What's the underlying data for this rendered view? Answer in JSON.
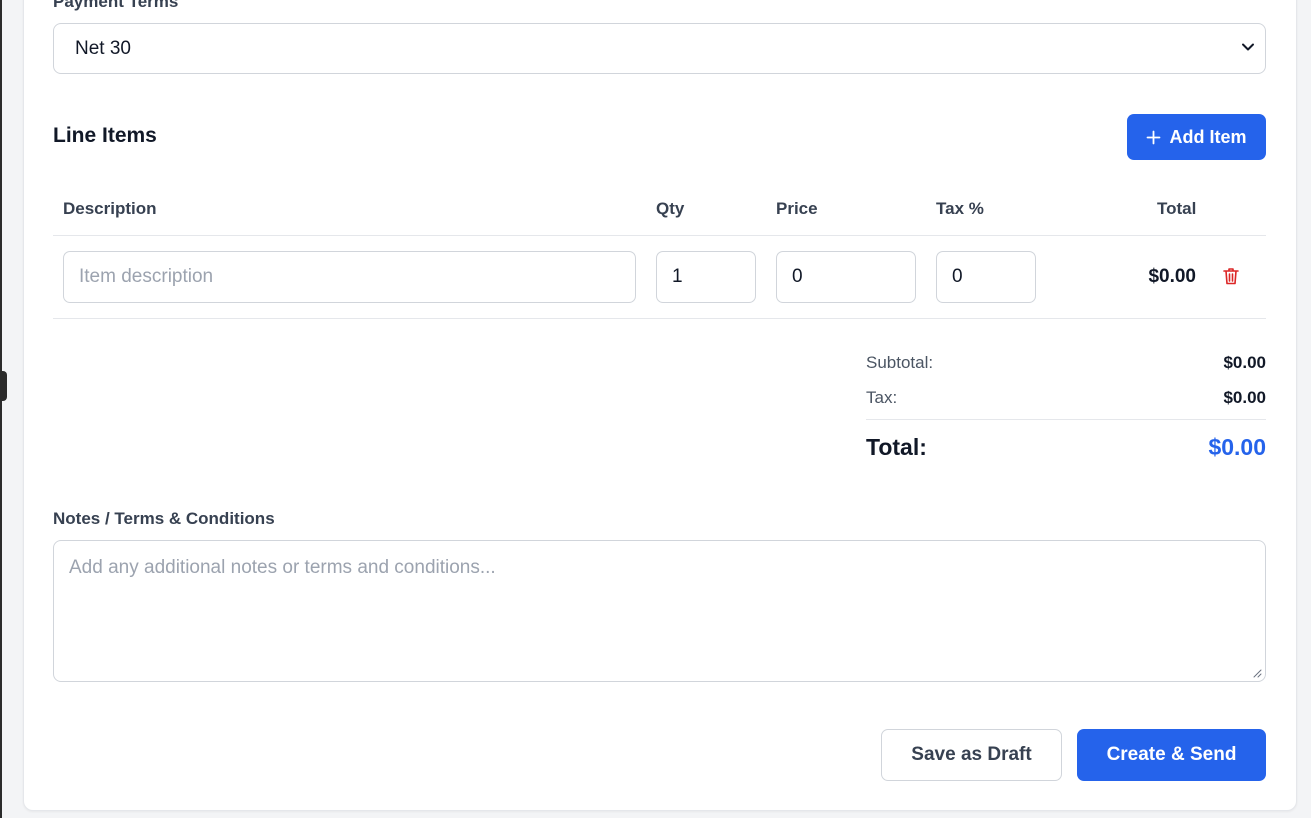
{
  "payment_terms": {
    "label": "Payment Terms",
    "selected": "Net 30"
  },
  "line_items": {
    "title": "Line Items",
    "add_button": "Add Item",
    "columns": {
      "description": "Description",
      "qty": "Qty",
      "price": "Price",
      "tax": "Tax %",
      "total": "Total"
    },
    "rows": [
      {
        "description_placeholder": "Item description",
        "description": "",
        "qty": "1",
        "price": "0",
        "tax": "0",
        "total": "$0.00"
      }
    ]
  },
  "summary": {
    "subtotal_label": "Subtotal:",
    "subtotal": "$0.00",
    "tax_label": "Tax:",
    "tax": "$0.00",
    "total_label": "Total:",
    "total": "$0.00"
  },
  "notes": {
    "label": "Notes / Terms & Conditions",
    "placeholder": "Add any additional notes or terms and conditions..."
  },
  "actions": {
    "save_draft": "Save as Draft",
    "create_send": "Create & Send"
  },
  "colors": {
    "accent": "#2563eb",
    "danger": "#dc2626"
  },
  "icons": {
    "add": "plus-icon",
    "delete": "trash-icon",
    "select": "chevron-down-icon"
  }
}
